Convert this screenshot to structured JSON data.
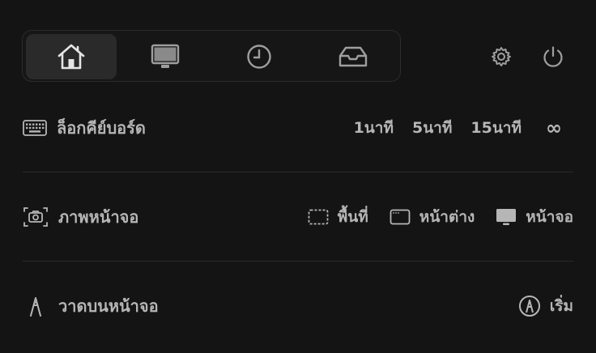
{
  "tabs": [
    {
      "name": "home",
      "icon": "home-icon",
      "active": true
    },
    {
      "name": "display",
      "icon": "monitor-icon",
      "active": false
    },
    {
      "name": "history",
      "icon": "clock-icon",
      "active": false
    },
    {
      "name": "inbox",
      "icon": "inbox-icon",
      "active": false
    }
  ],
  "top_actions": {
    "settings_icon": "gear-icon",
    "power_icon": "power-icon"
  },
  "keyboard": {
    "label": "ล็อกคีย์บอร์ด",
    "durations": [
      "1นาที",
      "5นาที",
      "15นาที"
    ],
    "infinite": "∞"
  },
  "screenshot": {
    "label": "ภาพหน้าจอ",
    "options": [
      "พื้นที่",
      "หน้าต่าง",
      "หน้าจอ"
    ]
  },
  "draw": {
    "label": "วาดบนหน้าจอ",
    "start": "เริ่ม"
  },
  "colors": {
    "background": "#141414",
    "text": "#b6b6b6",
    "active_tab": "#2a2a2a"
  }
}
